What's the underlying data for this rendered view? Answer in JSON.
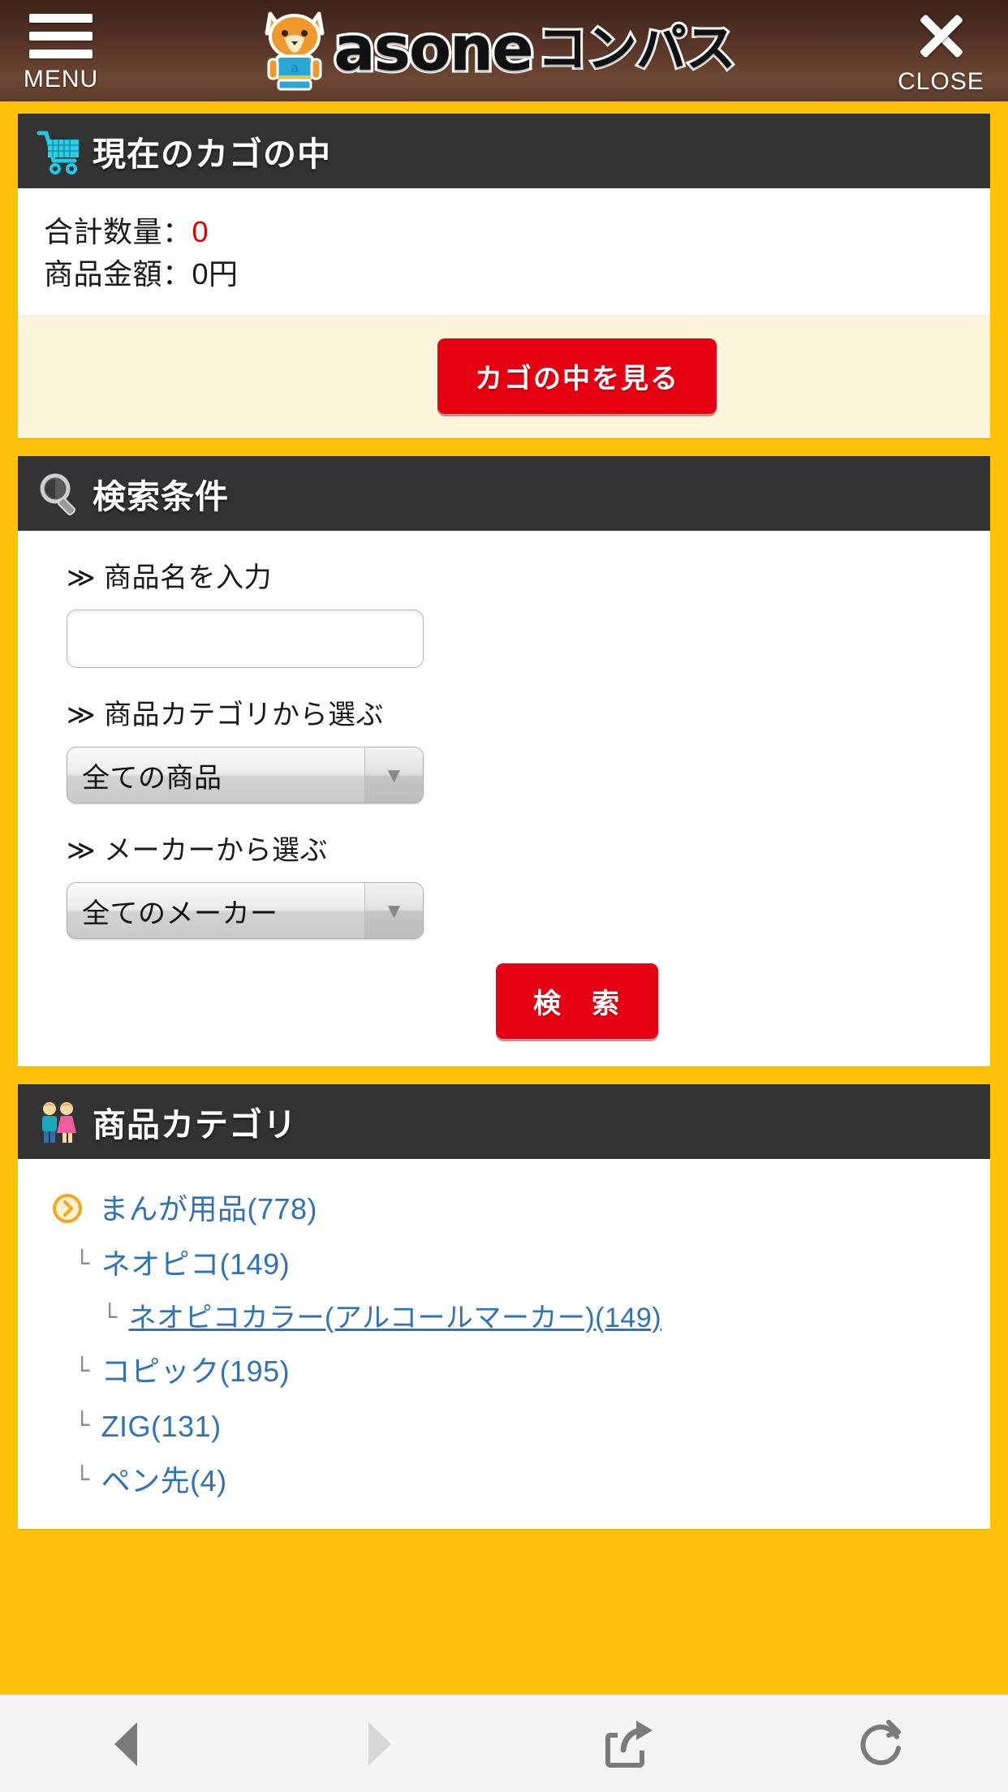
{
  "header": {
    "menu_label": "MENU",
    "menu_icon": "hamburger-icon",
    "brand_word": "asone",
    "brand_kana": "コンパス",
    "mascot_icon": "fox-mascot-icon",
    "close_label": "CLOSE",
    "close_icon": "close-x-icon",
    "background_color": "#5e3d2c"
  },
  "theme": {
    "page_background": "#FFC107",
    "panel_header_background": "#333333",
    "accent_red": "#e50012",
    "link_blue": "#2f72b8",
    "cart_action_background": "#fdf6dc"
  },
  "cart": {
    "title": "現在のカゴの中",
    "icon": "shopping-cart-icon",
    "qty_label": "合計数量：",
    "qty_value": "0",
    "amount_label": "商品金額：",
    "amount_value": "0円",
    "view_button": "カゴの中を見る"
  },
  "search": {
    "title": "検索条件",
    "icon": "magnifier-icon",
    "name_label": "≫ 商品名を入力",
    "name_value": "",
    "name_placeholder": "",
    "category_label": "≫ 商品カテゴリから選ぶ",
    "category_selected": "全ての商品",
    "maker_label": "≫ メーカーから選ぶ",
    "maker_selected": "全てのメーカー",
    "submit_button": "検　索"
  },
  "categories": {
    "title": "商品カテゴリ",
    "icon": "two-people-icon",
    "items": [
      {
        "label": "まんが用品(778)",
        "level": 1,
        "bullet": "circle-chevron-icon",
        "current": false
      },
      {
        "label": "ネオピコ(149)",
        "level": 2,
        "bullet": "branch-mark",
        "current": false
      },
      {
        "label": "ネオピコカラー(アルコールマーカー)(149)",
        "level": 3,
        "bullet": "branch-mark",
        "current": true
      },
      {
        "label": "コピック(195)",
        "level": 2,
        "bullet": "branch-mark",
        "current": false
      },
      {
        "label": "ZIG(131)",
        "level": 2,
        "bullet": "branch-mark",
        "current": false
      },
      {
        "label": "ペン先(4)",
        "level": 2,
        "bullet": "branch-mark",
        "current": false
      }
    ],
    "branch_mark": "└"
  },
  "browser_bar": {
    "back_icon": "back-triangle-icon",
    "forward_icon": "forward-triangle-icon",
    "share_icon": "share-icon",
    "reload_icon": "reload-icon"
  }
}
